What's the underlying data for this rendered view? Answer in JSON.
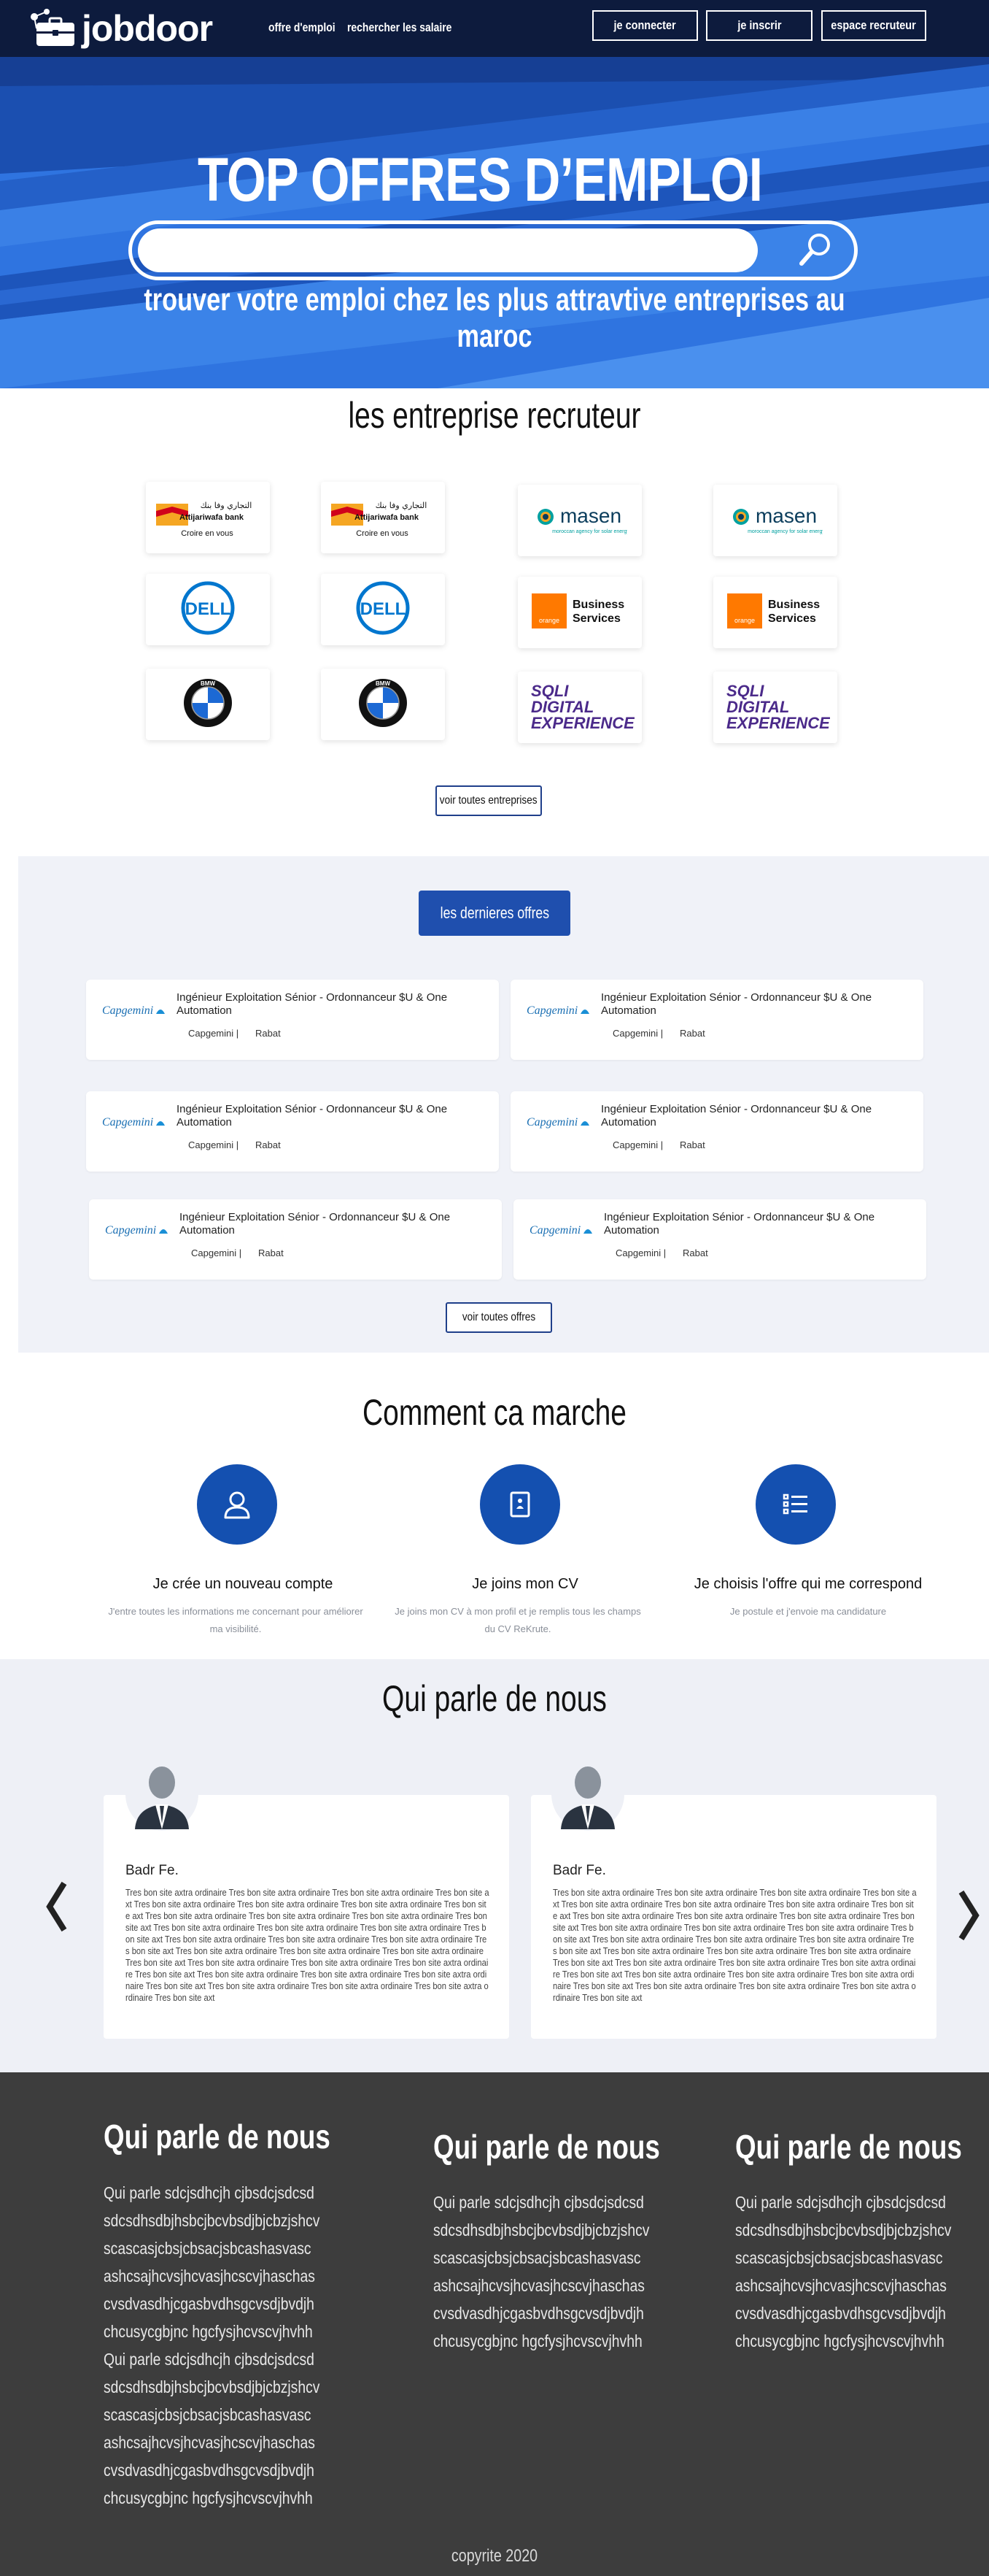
{
  "header": {
    "brand": "jobdoor",
    "nav": [
      "offre d'emploi",
      "rechercher les salaire"
    ],
    "connect_label": "je connecter",
    "register_label": "je inscrir",
    "recruiter_label": "espace recruteur"
  },
  "hero": {
    "title": "TOP OFFRES D’EMPLOI",
    "search_placeholder": "",
    "subtitle": "trouver votre emploi chez les plus attravtive entreprises au maroc"
  },
  "companies": {
    "title": "les entreprise recruteur",
    "logos": [
      {
        "name": "Attijariwafa bank",
        "tagline": "Croire en vous",
        "arabic": "التجاري وفا بنك",
        "icon": "attijariwafa-logo"
      },
      {
        "name": "Attijariwafa bank",
        "tagline": "Croire en vous",
        "arabic": "التجاري وفا بنك",
        "icon": "attijariwafa-logo"
      },
      {
        "name": "masen",
        "tagline": "moroccan agency for solar energy",
        "icon": "masen-logo"
      },
      {
        "name": "masen",
        "tagline": "moroccan agency for solar energy",
        "icon": "masen-logo"
      },
      {
        "name": "DELL",
        "icon": "dell-logo"
      },
      {
        "name": "DELL",
        "icon": "dell-logo"
      },
      {
        "name": "Business Services",
        "brand": "orange",
        "icon": "orange-logo"
      },
      {
        "name": "Business Services",
        "brand": "orange",
        "icon": "orange-logo"
      },
      {
        "name": "BMW",
        "icon": "bmw-logo"
      },
      {
        "name": "BMW",
        "icon": "bmw-logo"
      },
      {
        "name": "SQLI DIGITAL EXPERIENCE",
        "line1": "SQLI",
        "line2": "DIGITAL",
        "line3": "EXPERIENCE",
        "icon": "sqli-logo"
      },
      {
        "name": "SQLI DIGITAL EXPERIENCE",
        "line1": "SQLI",
        "line2": "DIGITAL",
        "line3": "EXPERIENCE",
        "icon": "sqli-logo"
      }
    ],
    "see_all_label": "voir toutes entreprises"
  },
  "offers": {
    "title": "les dernieres offres",
    "items": [
      {
        "logo": "Capgemini",
        "title": "Ingénieur Exploitation Sénior - Ordonnanceur $U & One Automation",
        "company": "Capgemini |",
        "city": "Rabat"
      },
      {
        "logo": "Capgemini",
        "title": "Ingénieur Exploitation Sénior - Ordonnanceur $U & One Automation",
        "company": "Capgemini |",
        "city": "Rabat"
      },
      {
        "logo": "Capgemini",
        "title": "Ingénieur Exploitation Sénior - Ordonnanceur $U & One Automation",
        "company": "Capgemini |",
        "city": "Rabat"
      },
      {
        "logo": "Capgemini",
        "title": "Ingénieur Exploitation Sénior - Ordonnanceur $U & One Automation",
        "company": "Capgemini |",
        "city": "Rabat"
      },
      {
        "logo": "Capgemini",
        "title": "Ingénieur Exploitation Sénior - Ordonnanceur $U & One Automation",
        "company": "Capgemini |",
        "city": "Rabat"
      },
      {
        "logo": "Capgemini",
        "title": "Ingénieur Exploitation Sénior - Ordonnanceur $U & One Automation",
        "company": "Capgemini |",
        "city": "Rabat"
      }
    ],
    "see_all_label": "voir toutes offres"
  },
  "how": {
    "title": "Comment ca marche",
    "steps": [
      {
        "icon": "user-icon",
        "title": "Je crée un nouveau compte",
        "desc": "J'entre toutes les informations me concernant pour améliorer ma visibilité."
      },
      {
        "icon": "cv-document-icon",
        "title": "Je joins mon CV",
        "desc": "Je joins mon CV à mon profil et je remplis tous les champs du CV ReKrute."
      },
      {
        "icon": "list-icon",
        "title": "Je choisis l'offre qui me correspond",
        "desc": "Je postule et j'envoie ma candidature"
      }
    ]
  },
  "testimonials": {
    "title": "Qui parle de nous",
    "items": [
      {
        "name": "Badr Fe.",
        "text": "Tres bon site axtra ordinaire Tres bon site axtra ordinaire Tres bon site axtra ordinaire Tres bon site axt Tres bon site axtra ordinaire Tres bon site axtra ordinaire Tres bon site axtra ordinaire Tres bon site axt Tres bon site axtra ordinaire Tres bon site axtra ordinaire Tres bon site axtra ordinaire Tres bon site axt Tres bon site axtra ordinaire Tres bon site axtra ordinaire Tres bon site axtra ordinaire Tres bon site axt Tres bon site axtra ordinaire Tres bon site axtra ordinaire Tres bon site axtra ordinaire Tres bon site axt Tres bon site axtra ordinaire Tres bon site axtra ordinaire Tres bon site axtra ordinaire Tres bon site axt Tres bon site axtra ordinaire Tres bon site axtra ordinaire Tres bon site axtra ordinaire Tres bon site axt Tres bon site axtra ordinaire Tres bon site axtra ordinaire Tres bon site axtra ordinaire Tres bon site axt Tres bon site axtra ordinaire Tres bon site axtra ordinaire Tres bon site axtra ordinaire Tres bon site axt"
      },
      {
        "name": "Badr Fe.",
        "text": "Tres bon site axtra ordinaire Tres bon site axtra ordinaire Tres bon site axtra ordinaire Tres bon site axt Tres bon site axtra ordinaire Tres bon site axtra ordinaire Tres bon site axtra ordinaire Tres bon site axt Tres bon site axtra ordinaire Tres bon site axtra ordinaire Tres bon site axtra ordinaire Tres bon site axt Tres bon site axtra ordinaire Tres bon site axtra ordinaire Tres bon site axtra ordinaire Tres bon site axt Tres bon site axtra ordinaire Tres bon site axtra ordinaire Tres bon site axtra ordinaire Tres bon site axt Tres bon site axtra ordinaire Tres bon site axtra ordinaire Tres bon site axtra ordinaire Tres bon site axt Tres bon site axtra ordinaire Tres bon site axtra ordinaire Tres bon site axtra ordinaire Tres bon site axt Tres bon site axtra ordinaire Tres bon site axtra ordinaire Tres bon site axtra ordinaire Tres bon site axt Tres bon site axtra ordinaire Tres bon site axtra ordinaire Tres bon site axtra ordinaire Tres bon site axt"
      }
    ]
  },
  "footer": {
    "columns": [
      {
        "title": "Qui parle de nous",
        "lines": [
          "Qui parle sdcjsdhcjh cjbsdcjsdcsd",
          "sdcsdhsdbjhsbcjbcvbsdjbjcbzjshcv",
          "scascasjcbsjcbsacjsbcashasvasc",
          "ashcsajhcvsjhcvasjhcscvjhaschas",
          "cvsdvasdhjcgasbvdhsgcvsdjbvdjh",
          "chcusycgbjnc hgcfysjhcvscvjhvhh",
          "Qui parle sdcjsdhcjh cjbsdcjsdcsd",
          "sdcsdhsdbjhsbcjbcvbsdjbjcbzjshcv",
          "scascasjcbsjcbsacjsbcashasvasc",
          "ashcsajhcvsjhcvasjhcscvjhaschas",
          "cvsdvasdhjcgasbvdhsgcvsdjbvdjh",
          "chcusycgbjnc hgcfysjhcvscvjhvhh"
        ]
      },
      {
        "title": "Qui parle de nous",
        "lines": [
          "Qui parle sdcjsdhcjh cjbsdcjsdcsd",
          "sdcsdhsdbjhsbcjbcvbsdjbjcbzjshcv",
          "scascasjcbsjcbsacjsbcashasvasc",
          "ashcsajhcvsjhcvasjhcscvjhaschas",
          "cvsdvasdhjcgasbvdhsgcvsdjbvdjh",
          "chcusycgbjnc hgcfysjhcvscvjhvhh"
        ]
      },
      {
        "title": "Qui parle de nous",
        "lines": [
          "Qui parle sdcjsdhcjh cjbsdcjsdcsd",
          "sdcsdhsdbjhsbcjbcvbsdjbjcbzjshcv",
          "scascasjcbsjcbsacjsbcashasvasc",
          "ashcsajhcvsjhcvasjhcscvjhaschas",
          "cvsdvasdhjcgasbvdhsgcvsdjbvdjh",
          "chcusycgbjnc hgcfysjhcvscvjhvhh"
        ]
      }
    ],
    "copyright": "copyrite 2020"
  },
  "colors": {
    "header_bg": "#0d1b3d",
    "hero_blue": "#2a6ad8",
    "accent_blue": "#1450b0",
    "offers_bg": "#f0f2f8",
    "footer_bg": "#3d3d3d"
  }
}
